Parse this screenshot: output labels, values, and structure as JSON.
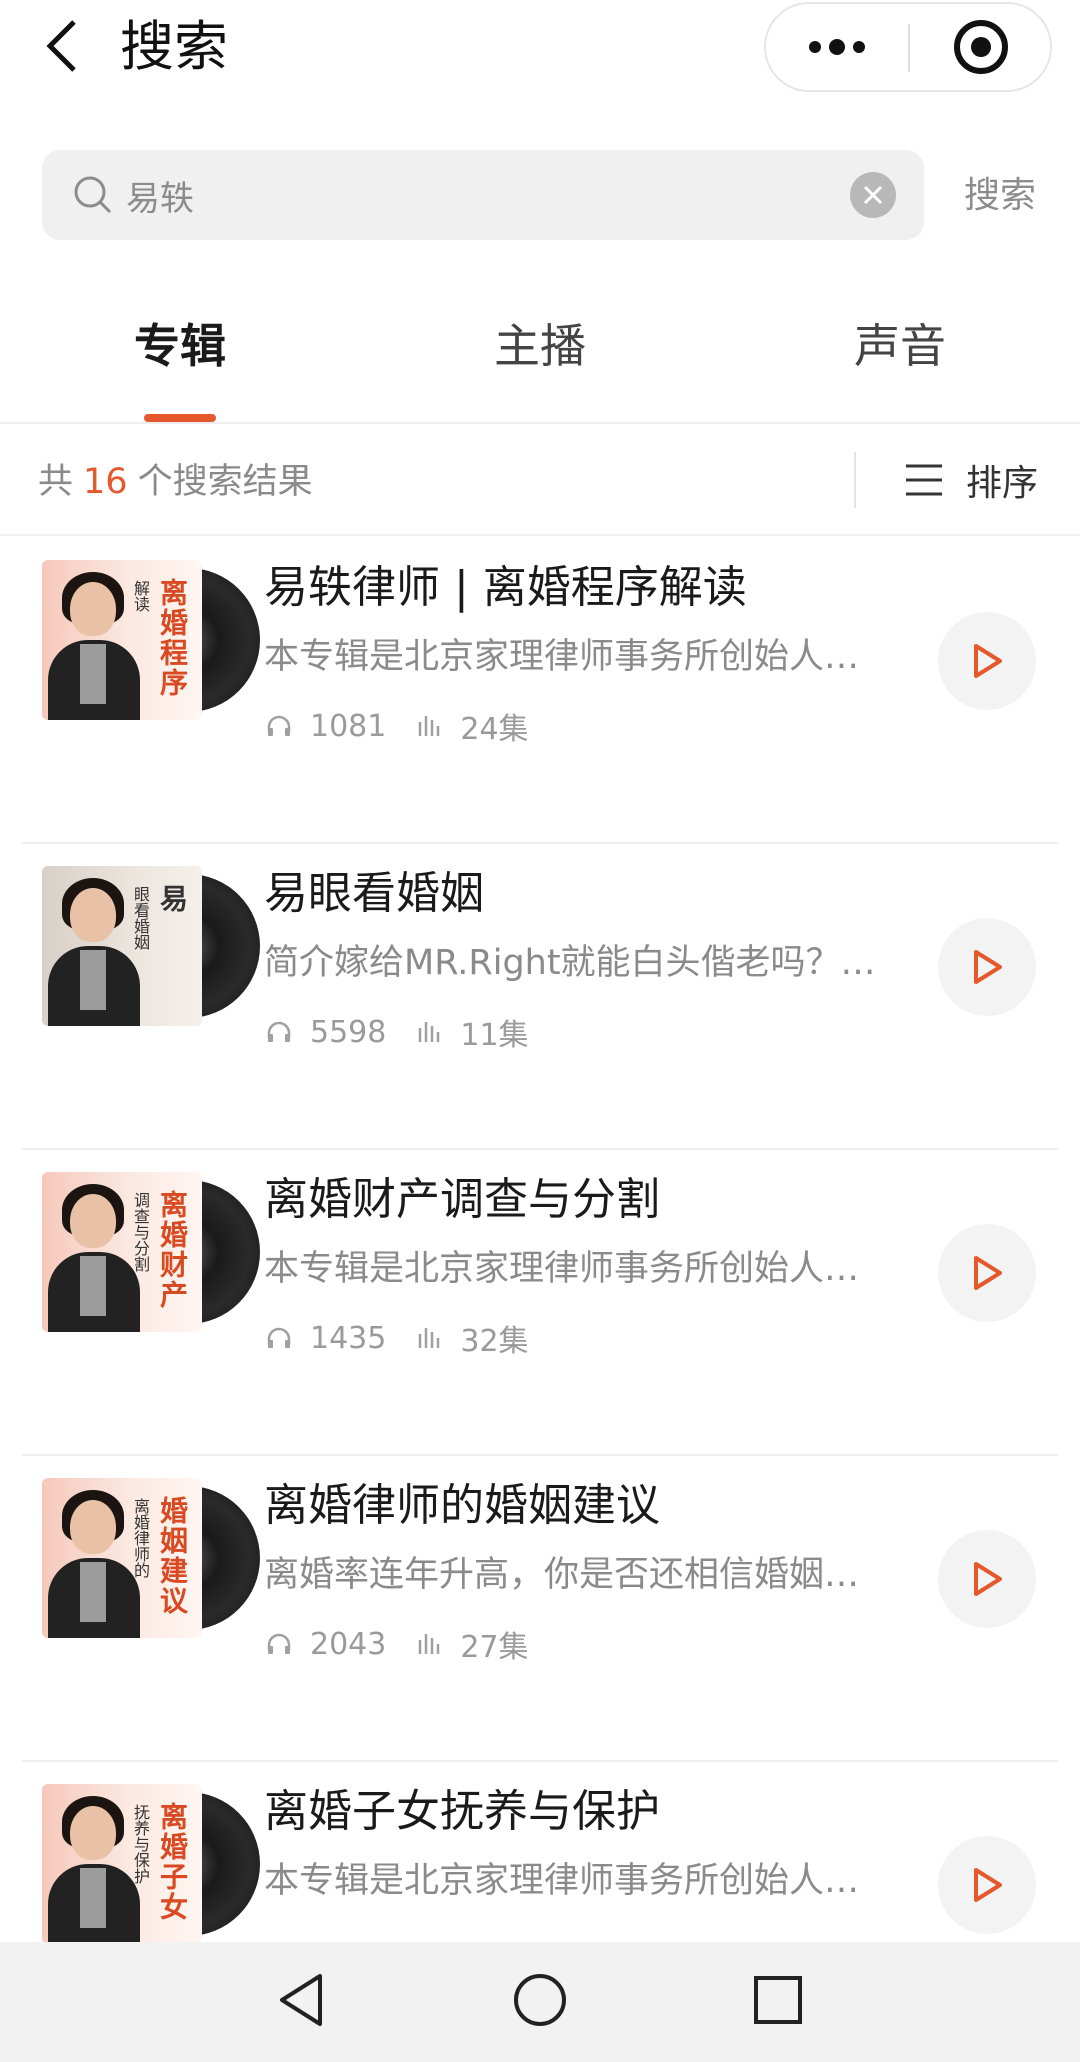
{
  "header": {
    "title": "搜索"
  },
  "search": {
    "value": "易轶",
    "submit_label": "搜索"
  },
  "tabs": [
    {
      "label": "专辑",
      "active": true
    },
    {
      "label": "主播",
      "active": false
    },
    {
      "label": "声音",
      "active": false
    }
  ],
  "summary": {
    "prefix": "共",
    "count": "16",
    "suffix": "个搜索结果",
    "sort_label": "排序"
  },
  "albums": [
    {
      "title": "易轶律师 | 离婚程序解读",
      "desc": "本专辑是北京家理律师事务所创始人…",
      "plays": "1081",
      "episodes": "24集",
      "cover_title": "离婚程序",
      "cover_sub": "解读"
    },
    {
      "title": "易眼看婚姻",
      "desc": "简介嫁给MR.Right就能白头偕老吗？…",
      "plays": "5598",
      "episodes": "11集",
      "cover_title": "易",
      "cover_sub": "眼看婚姻"
    },
    {
      "title": "离婚财产调查与分割",
      "desc": "本专辑是北京家理律师事务所创始人…",
      "plays": "1435",
      "episodes": "32集",
      "cover_title": "离婚财产",
      "cover_sub": "调查与分割"
    },
    {
      "title": "离婚律师的婚姻建议",
      "desc": "离婚率连年升高，你是否还相信婚姻…",
      "plays": "2043",
      "episodes": "27集",
      "cover_title": "婚姻建议",
      "cover_sub": "离婚律师的"
    },
    {
      "title": "离婚子女抚养与保护",
      "desc": "本专辑是北京家理律师事务所创始人…",
      "plays": "",
      "episodes": "",
      "cover_title": "离婚子女",
      "cover_sub": "抚养与保护"
    }
  ],
  "colors": {
    "accent": "#e4582b",
    "muted_text": "#8a8a8a"
  }
}
